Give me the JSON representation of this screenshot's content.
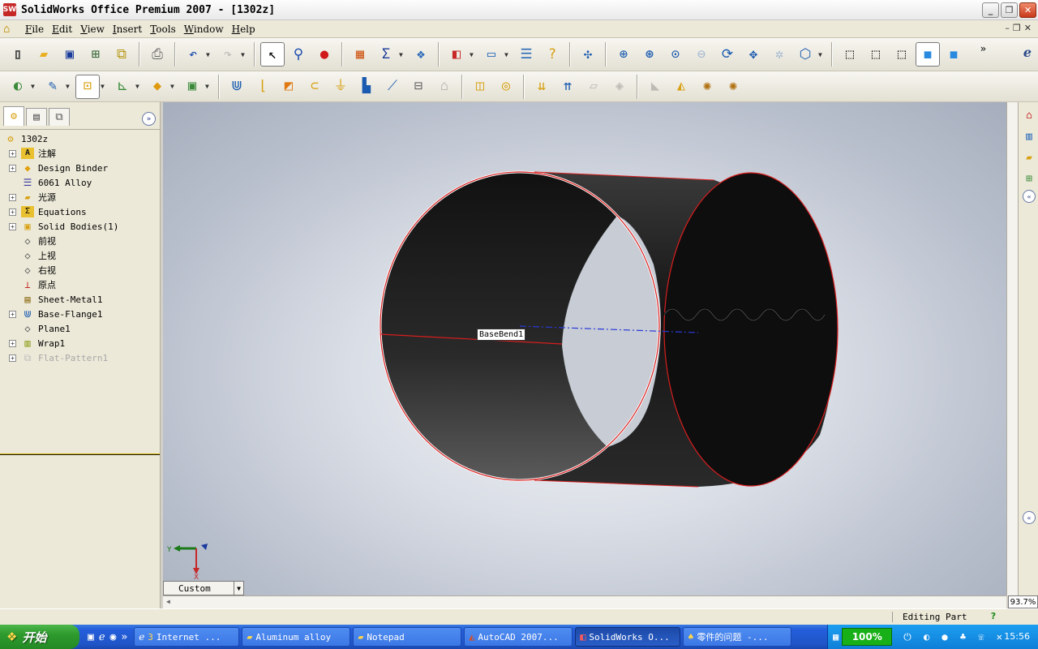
{
  "window": {
    "title": "SolidWorks Office Premium 2007 - [1302z]",
    "app_icon": "SW",
    "controls": [
      "_",
      "❐",
      "✕"
    ]
  },
  "menubar": {
    "items": [
      "File",
      "Edit",
      "View",
      "Insert",
      "Tools",
      "Window",
      "Help"
    ],
    "doc_controls": [
      "–",
      "❐",
      "✕"
    ]
  },
  "toolbar1": {
    "icons": [
      "new-icon",
      "open-icon",
      "save-icon",
      "make-drawing-icon",
      "make-assembly-icon",
      "print-icon",
      "undo-icon",
      "redo-icon",
      "select-icon",
      "selection-filter-icon",
      "rebuild-icon",
      "color-palette-icon",
      "sum-options-icon",
      "photoworks-icon",
      "solidworks-resources-icon",
      "window-icon",
      "properties-icon",
      "help-icon",
      "zoom-to-fit-icon",
      "zoom-to-area-icon",
      "zoom-in-out-icon",
      "zoom-to-selection-icon",
      "rotate-view-icon",
      "pan-icon",
      "roll-view-icon",
      "standard-views-icon",
      "wireframe-icon",
      "hidden-lines-visible-icon",
      "hidden-lines-removed-icon",
      "shaded-with-edges-icon",
      "shaded-icon",
      "e-drawings-icon"
    ],
    "more_label": "»",
    "e_label": "e"
  },
  "toolbar2": {
    "icons": [
      "sketch-icon",
      "smart-dimension-icon",
      "reference-geometry-icon",
      "coordinate-icon",
      "plane-icon",
      "features-icon",
      "base-flange-icon",
      "edge-flange-icon",
      "miter-flange-icon",
      "hem-icon",
      "jog-icon",
      "sketched-bend-icon",
      "cross-break-icon",
      "closed-corner-icon",
      "unfold-icon",
      "fold-icon",
      "flatten-icon",
      "no-bends-icon",
      "insert-bends-icon",
      "rip-icon",
      "convert-to-sheet-metal-icon",
      "lofted-bend-icon",
      "break-corner-icon",
      "forming-tool-icon",
      "vent-icon",
      "sheet-metal-gusset-icon"
    ]
  },
  "feature_tree": {
    "tabs": [
      "featuremanager-tab",
      "propertymanager-tab",
      "configurationmanager-tab"
    ],
    "expand_label": "»",
    "items": [
      {
        "label": "1302z",
        "icon": "part-icon",
        "expand": ""
      },
      {
        "label": "注解",
        "icon": "annotations-icon",
        "expand": "+"
      },
      {
        "label": "Design Binder",
        "icon": "design-binder-icon",
        "expand": "+"
      },
      {
        "label": "6061 Alloy",
        "icon": "material-icon",
        "expand": ""
      },
      {
        "label": "光源",
        "icon": "lights-icon",
        "expand": "+"
      },
      {
        "label": "Equations",
        "icon": "equations-icon",
        "expand": "+"
      },
      {
        "label": "Solid Bodies(1)",
        "icon": "solid-bodies-icon",
        "expand": "+"
      },
      {
        "label": "前视",
        "icon": "plane-icon",
        "expand": ""
      },
      {
        "label": "上视",
        "icon": "plane-icon",
        "expand": ""
      },
      {
        "label": "右视",
        "icon": "plane-icon",
        "expand": ""
      },
      {
        "label": "原点",
        "icon": "origin-icon",
        "expand": ""
      },
      {
        "label": "Sheet-Metal1",
        "icon": "sheet-metal-icon",
        "expand": ""
      },
      {
        "label": "Base-Flange1",
        "icon": "base-flange-icon",
        "expand": "+"
      },
      {
        "label": "Plane1",
        "icon": "plane-icon",
        "expand": ""
      },
      {
        "label": "Wrap1",
        "icon": "wrap-icon",
        "expand": "+"
      },
      {
        "label": "Flat-Pattern1",
        "icon": "flat-pattern-icon",
        "expand": "+"
      }
    ]
  },
  "viewport": {
    "callout": "BaseBend1",
    "view_orientation": "Custom",
    "triad": {
      "y": "Y",
      "x": "X"
    },
    "model_color": "#1a1a1a",
    "edge_color": "#d81e1e"
  },
  "taskpane": {
    "icons": [
      "solidworks-resources-icon",
      "design-library-icon",
      "file-explorer-icon",
      "view-palette-icon"
    ],
    "collapse_label": "«",
    "expand_label": "«"
  },
  "zoom_level": "93.7%",
  "statusbar": {
    "text": "Editing Part",
    "help": "?"
  },
  "taskbar": {
    "start_label": "开始",
    "tasks": [
      {
        "icon": "ie-icon",
        "count": "3",
        "label": "Internet ..."
      },
      {
        "icon": "folder-icon",
        "count": "",
        "label": "Aluminum alloy"
      },
      {
        "icon": "folder-icon",
        "count": "",
        "label": "Notepad"
      },
      {
        "icon": "autocad-icon",
        "count": "",
        "label": "AutoCAD 2007..."
      },
      {
        "icon": "solidworks-icon",
        "count": "",
        "label": "SolidWorks O..."
      },
      {
        "icon": "forum-icon",
        "count": "",
        "label": "零件的问题 -..."
      }
    ],
    "tray_percent": "100%",
    "clock": "15:56"
  }
}
